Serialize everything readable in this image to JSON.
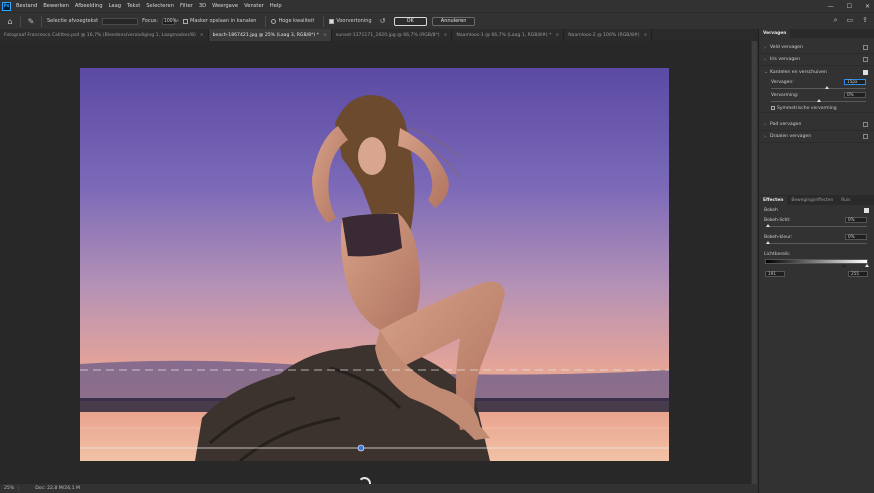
{
  "menu": {
    "logo": "Ps",
    "items": [
      "Bestand",
      "Bewerken",
      "Afbeelding",
      "Laag",
      "Tekst",
      "Selecteren",
      "Filter",
      "3D",
      "Weergave",
      "Venster",
      "Help"
    ],
    "window_controls": [
      "—",
      "☐",
      "✕"
    ]
  },
  "options": {
    "selection_label": "Selectie afvoegtekst",
    "focus_label": "Focus:",
    "focus_value": "100%",
    "save_mask_label": "Masker opslaan in kanalen",
    "high_quality_label": "Hoge kwaliteit",
    "preview_label": "Voorvertoning",
    "ok_label": "OK",
    "cancel_label": "Annuleren"
  },
  "tabs": [
    {
      "label": "Fotograaf Francesco Calitteo.psd @ 16,7% (Bleedens/verzadiging 1, Laagmasker/8)",
      "active": false
    },
    {
      "label": "beach-1867421.jpg @ 25% (Laag 3, RGB/8*) *",
      "active": true
    },
    {
      "label": "sunset-1371171_1920.jpg @ 66,7% (RGB/8*)",
      "active": false
    },
    {
      "label": "Naamloos-1 @ 66,7% (Laag 1, RGB/8#) *",
      "active": false
    },
    {
      "label": "Naamloos-2 @ 100% (RGB/8#)",
      "active": false
    }
  ],
  "status": {
    "zoom": "25%",
    "doc": "Doc: 22,8 M/26,1 M"
  },
  "blur_panel": {
    "tab": "Vervagen",
    "rows": [
      {
        "label": "Veld vervagen",
        "checked": false,
        "expanded": false
      },
      {
        "label": "Iris vervagen",
        "checked": false,
        "expanded": false
      },
      {
        "label": "Kantelen en verschuiven",
        "checked": true,
        "expanded": true
      }
    ],
    "blur_label": "Vervagen:",
    "blur_value": "15px",
    "blur_level": 0.58,
    "distortion_label": "Vervorming:",
    "distortion_value": "0%",
    "distortion_level": 0.5,
    "symmetric_label": "Symmetrische vervorming",
    "rows_after": [
      {
        "label": "Pad vervagen",
        "checked": false
      },
      {
        "label": "Draaien vervagen",
        "checked": false
      }
    ]
  },
  "effects_panel": {
    "tabs": [
      "Effecten",
      "Bewegingseffecten",
      "Ruis"
    ],
    "bokeh_label": "Bokeh",
    "bokeh_checked": true,
    "light_label": "Bokeh-licht:",
    "light_value": "0%",
    "color_label": "Bokeh-kleur:",
    "color_value": "0%",
    "range_label": "Lichtbereik:",
    "range_low": "191",
    "range_high": "255"
  },
  "colors": {
    "ui_bg": "#323232",
    "canvas_bg": "#282828",
    "accent": "#31a8ff",
    "pin": "#3c78d8"
  }
}
